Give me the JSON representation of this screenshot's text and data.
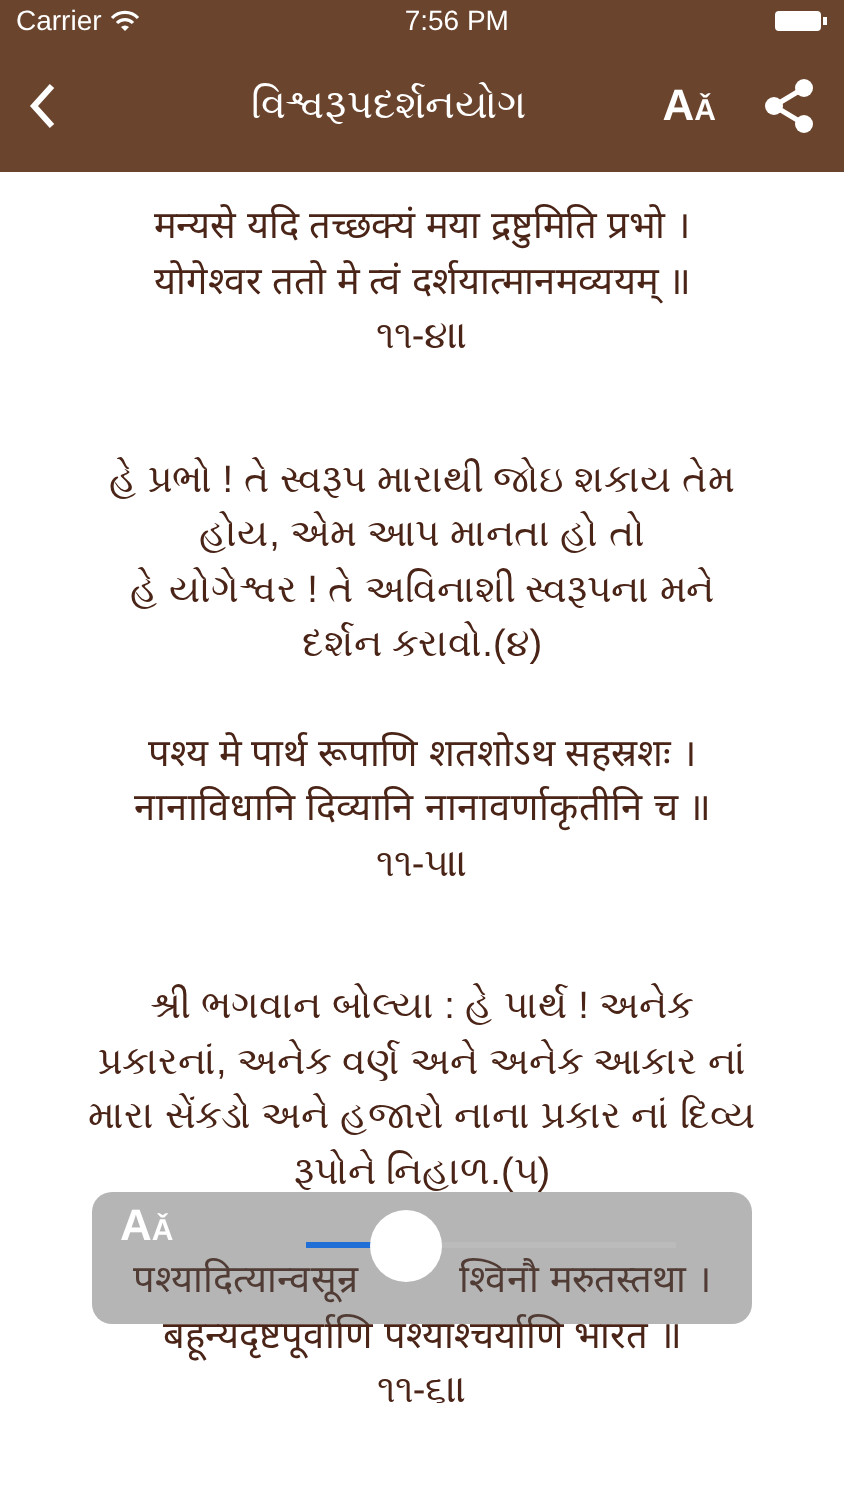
{
  "status_bar": {
    "carrier": "Carrier",
    "time": "7:56 PM"
  },
  "nav": {
    "title": "વિશ્વરૂપદર્શનયોગ",
    "font_button": {
      "big": "A",
      "small": "Ǎ"
    }
  },
  "verses": [
    {
      "kind": "sanskrit",
      "lines": [
        "मन्यसे यदि तच्छक्यं मया द्रष्टुमिति प्रभो ।",
        "योगेश्वर ततो मे त्वं दर्शयात्मानमव्ययम् ॥",
        "૧૧-૪॥"
      ]
    },
    {
      "kind": "translation",
      "lines": [
        "હે પ્રભો ! તે સ્વરૂપ મારાથી જોઇ શકાય તેમ",
        "હોય, એમ આપ માનતા હો તો",
        "હે યોગેશ્વર ! તે અવિનાશી સ્વરૂપના મને",
        "દર્શન કરાવો.(૪)"
      ]
    },
    {
      "kind": "sanskrit",
      "lines": [
        "पश्य मे पार्थ रूपाणि शतशोऽथ सहस्रशः ।",
        "नानाविधानि दिव्यानि नानावर्णाकृतीनि च ॥",
        "૧૧-૫॥"
      ]
    },
    {
      "kind": "translation",
      "lines": [
        "શ્રી ભગવાન બોલ્યા : હે પાર્થ ! અનેક",
        "પ્રકારનાં, અનેક વર્ણ અને અનેક આકાર નાં",
        "મારા સેંકડો અને હજારો નાના પ્રકાર નાં દિવ્ય",
        "રૂપોને નિહાળ.(૫)"
      ]
    },
    {
      "kind": "sanskrit",
      "lines": [
        [
          "पश्यादित्यान्वसून्र",
          "श्विनौ मरुतस्तथा ।"
        ],
        "बहून्यदृष्टपूर्वाणि पश्याश्चर्याणि भारत ॥",
        "૧૧-૬॥"
      ]
    }
  ],
  "font_popup": {
    "icon": {
      "big": "A",
      "small": "Ǎ"
    },
    "level": 0.27
  }
}
